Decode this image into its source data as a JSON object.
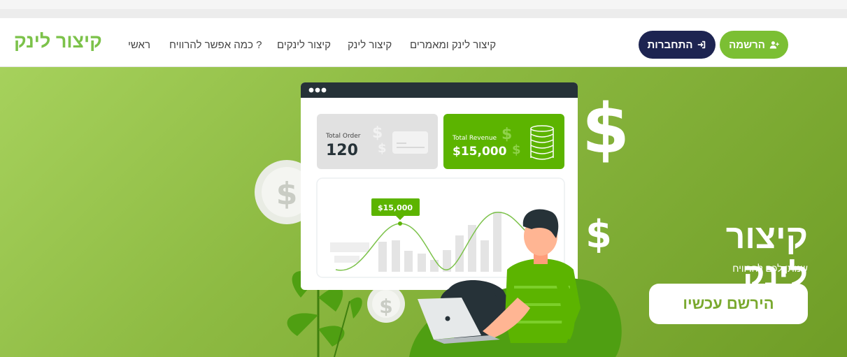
{
  "brand": {
    "name": "קיצור לינק",
    "color": "#7cc24a"
  },
  "nav": {
    "items": [
      {
        "label": "ראשי"
      },
      {
        "label": "? כמה אפשר להרוויח"
      },
      {
        "label": "קיצור לינקים"
      },
      {
        "label": "קיצור לינק"
      },
      {
        "label": "קיצור לינק ומאמרים"
      }
    ]
  },
  "auth": {
    "login_label": "התחברות",
    "login_icon": "sign-in-icon",
    "register_label": "הרשמה",
    "register_icon": "user-plus-icon",
    "login_color": "#1d2451",
    "register_color": "#7bbf33"
  },
  "hero": {
    "title": "קיצור לינק",
    "subtitle": "שנותן לכם להרוויח",
    "cta_label": "הירשם עכשיו"
  },
  "dashboard": {
    "order_label": "Total Order",
    "order_value": "120",
    "revenue_label": "Total Revenue",
    "revenue_value": "$15,000",
    "tooltip_value": "$15,000"
  }
}
